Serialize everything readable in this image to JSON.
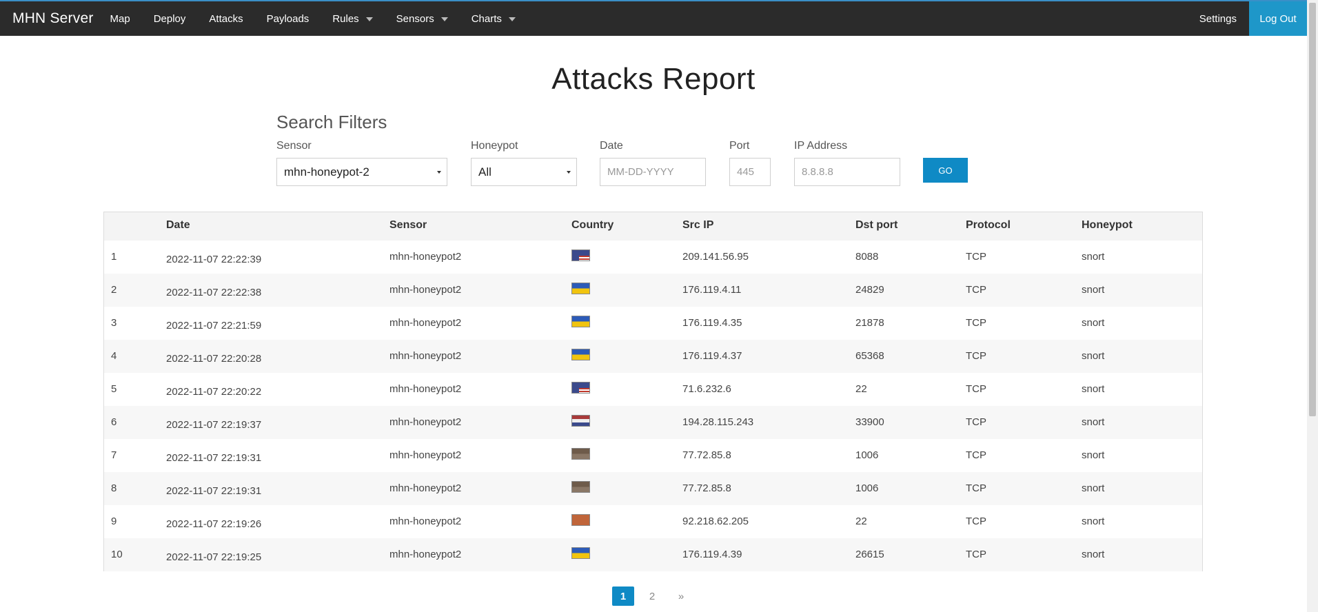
{
  "navbar": {
    "brand": "MHN Server",
    "items": [
      {
        "label": "Map",
        "dropdown": false
      },
      {
        "label": "Deploy",
        "dropdown": false
      },
      {
        "label": "Attacks",
        "dropdown": false
      },
      {
        "label": "Payloads",
        "dropdown": false
      },
      {
        "label": "Rules",
        "dropdown": true
      },
      {
        "label": "Sensors",
        "dropdown": true
      },
      {
        "label": "Charts",
        "dropdown": true
      }
    ],
    "settings": "Settings",
    "logout": "Log Out"
  },
  "page": {
    "title": "Attacks Report"
  },
  "filters": {
    "title": "Search Filters",
    "sensor_label": "Sensor",
    "sensor_value": "mhn-honeypot-2",
    "honeypot_label": "Honeypot",
    "honeypot_value": "All",
    "date_label": "Date",
    "date_placeholder": "MM-DD-YYYY",
    "port_label": "Port",
    "port_placeholder": "445",
    "ip_label": "IP Address",
    "ip_placeholder": "8.8.8.8",
    "go_label": "GO"
  },
  "table": {
    "headers": [
      "",
      "Date",
      "Sensor",
      "Country",
      "Src IP",
      "Dst port",
      "Protocol",
      "Honeypot"
    ],
    "rows": [
      {
        "n": "1",
        "date": "2022-11-07 22:22:39",
        "sensor": "mhn-honeypot2",
        "flag": "us-flag",
        "src_ip": "209.141.56.95",
        "dst_port": "8088",
        "protocol": "TCP",
        "honeypot": "snort"
      },
      {
        "n": "2",
        "date": "2022-11-07 22:22:38",
        "sensor": "mhn-honeypot2",
        "flag": "ua-flag",
        "src_ip": "176.119.4.11",
        "dst_port": "24829",
        "protocol": "TCP",
        "honeypot": "snort"
      },
      {
        "n": "3",
        "date": "2022-11-07 22:21:59",
        "sensor": "mhn-honeypot2",
        "flag": "ua-flag",
        "src_ip": "176.119.4.35",
        "dst_port": "21878",
        "protocol": "TCP",
        "honeypot": "snort"
      },
      {
        "n": "4",
        "date": "2022-11-07 22:20:28",
        "sensor": "mhn-honeypot2",
        "flag": "ua-flag",
        "src_ip": "176.119.4.37",
        "dst_port": "65368",
        "protocol": "TCP",
        "honeypot": "snort"
      },
      {
        "n": "5",
        "date": "2022-11-07 22:20:22",
        "sensor": "mhn-honeypot2",
        "flag": "us-flag",
        "src_ip": "71.6.232.6",
        "dst_port": "22",
        "protocol": "TCP",
        "honeypot": "snort"
      },
      {
        "n": "6",
        "date": "2022-11-07 22:19:37",
        "sensor": "mhn-honeypot2",
        "flag": "nl-flag",
        "src_ip": "194.28.115.243",
        "dst_port": "33900",
        "protocol": "TCP",
        "honeypot": "snort"
      },
      {
        "n": "7",
        "date": "2022-11-07 22:19:31",
        "sensor": "mhn-honeypot2",
        "flag": "brown-flag",
        "src_ip": "77.72.85.8",
        "dst_port": "1006",
        "protocol": "TCP",
        "honeypot": "snort"
      },
      {
        "n": "8",
        "date": "2022-11-07 22:19:31",
        "sensor": "mhn-honeypot2",
        "flag": "brown-flag",
        "src_ip": "77.72.85.8",
        "dst_port": "1006",
        "protocol": "TCP",
        "honeypot": "snort"
      },
      {
        "n": "9",
        "date": "2022-11-07 22:19:26",
        "sensor": "mhn-honeypot2",
        "flag": "orange-flag",
        "src_ip": "92.218.62.205",
        "dst_port": "22",
        "protocol": "TCP",
        "honeypot": "snort"
      },
      {
        "n": "10",
        "date": "2022-11-07 22:19:25",
        "sensor": "mhn-honeypot2",
        "flag": "ua-flag",
        "src_ip": "176.119.4.39",
        "dst_port": "26615",
        "protocol": "TCP",
        "honeypot": "snort"
      }
    ]
  },
  "pagination": {
    "pages": [
      "1",
      "2"
    ],
    "active": "1",
    "next": "»"
  },
  "colors": {
    "navbar_bg": "#2b2b2b",
    "accent": "#0f8ac5",
    "logout_bg": "#1e97c9"
  }
}
